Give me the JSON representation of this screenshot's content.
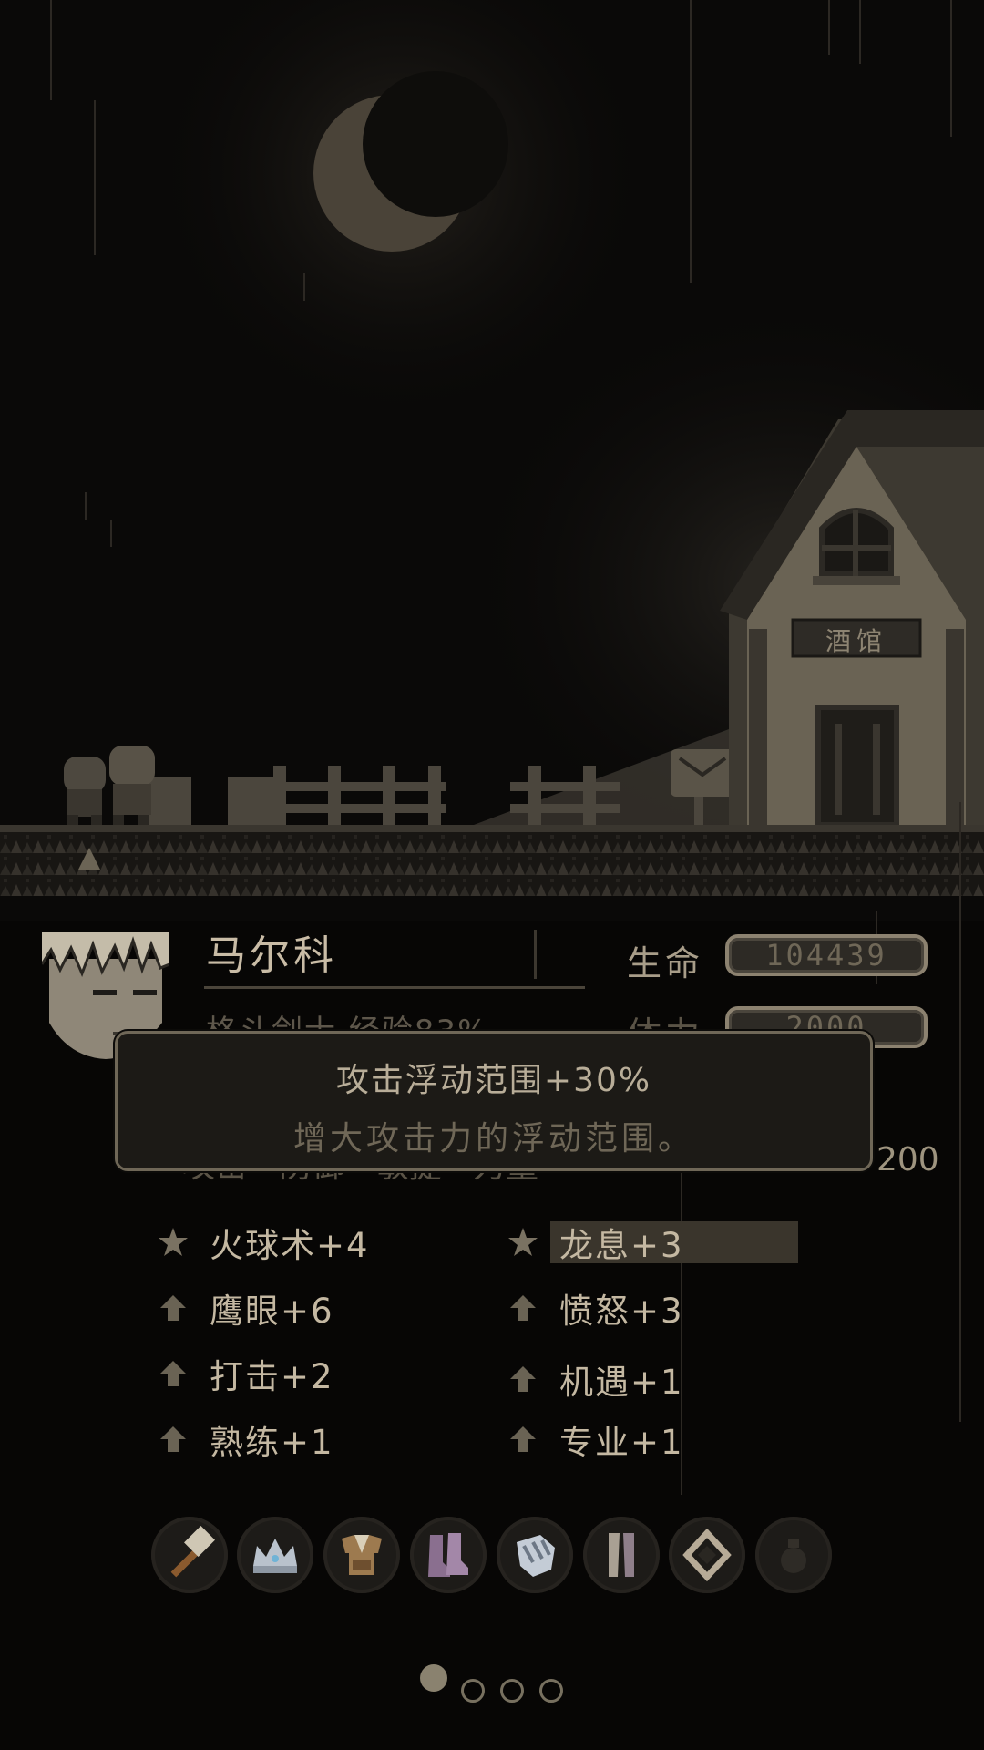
{
  "scene": {
    "tavern_sign": "酒馆"
  },
  "character": {
    "name": "马尔科",
    "subline": "格斗剑士  经验83%",
    "life_label": "生命",
    "life_value": "104439",
    "stamina_label": "体力",
    "stamina_value": "2000",
    "hidden_row": "攻击 · 防御 · 敏捷 · 力量",
    "hidden_row_tail": "200"
  },
  "tooltip": {
    "title": "攻击浮动范围+30%",
    "description": "增大攻击力的浮动范围。"
  },
  "skills": [
    {
      "label": "火球术+4",
      "icon": "star-icon",
      "highlight_chars": 1
    },
    {
      "label": "龙息+3",
      "icon": "star-icon",
      "highlight_chars": 2
    },
    {
      "label": "鹰眼+6",
      "icon": "up-arrow-icon",
      "highlight_chars": 1
    },
    {
      "label": "愤怒+3",
      "icon": "up-arrow-icon",
      "highlight_chars": 2
    },
    {
      "label": "打击+2",
      "icon": "up-arrow-icon",
      "highlight_chars": 1
    },
    {
      "label": "机遇+1",
      "icon": "up-arrow-icon",
      "highlight_chars": 3
    },
    {
      "label": "熟练+1",
      "icon": "up-arrow-icon",
      "highlight_chars": 2
    },
    {
      "label": "专业+1",
      "icon": "up-arrow-icon",
      "highlight_chars": 1
    }
  ],
  "equipment": [
    {
      "name": "hammer-icon"
    },
    {
      "name": "crown-icon"
    },
    {
      "name": "armor-icon"
    },
    {
      "name": "boots-icon"
    },
    {
      "name": "gauntlet-icon"
    },
    {
      "name": "leggings-icon"
    },
    {
      "name": "ring-icon"
    },
    {
      "name": "potion-icon"
    }
  ],
  "pagination": {
    "total": 4,
    "current": 1
  },
  "colors": {
    "background": "#070605",
    "text": "#c4b8a2",
    "frame": "#8c8270"
  }
}
